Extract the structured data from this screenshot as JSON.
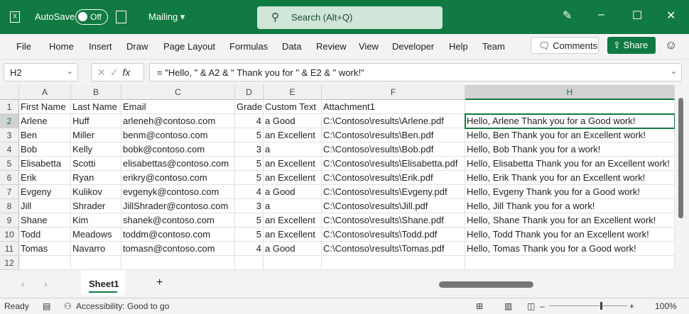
{
  "titlebar": {
    "autosave_label": "AutoSave",
    "autosave_state": "Off",
    "doc_name": "Mailing ▾",
    "search_placeholder": "Search (Alt+Q)"
  },
  "ribbon": {
    "tabs": [
      "File",
      "Home",
      "Insert",
      "Draw",
      "Page Layout",
      "Formulas",
      "Data",
      "Review",
      "View",
      "Developer",
      "Help",
      "Team"
    ],
    "comments": "Comments",
    "share": "Share"
  },
  "formula_bar": {
    "name_box": "H2",
    "fx": "fx",
    "formula": "= \"Hello, \" & A2 & \" Thank you for \" & E2 & \" work!\""
  },
  "grid": {
    "columns": [
      "A",
      "B",
      "C",
      "D",
      "E",
      "F",
      "H"
    ],
    "selected_column": "H",
    "active_cell": "H2",
    "rows": [
      [
        "First Name",
        "Last Name",
        "Email",
        "Grade",
        "Custom Text",
        "Attachment1",
        ""
      ],
      [
        "Arlene",
        "Huff",
        "arleneh@contoso.com",
        "4",
        "a Good",
        "C:\\Contoso\\results\\Arlene.pdf",
        "Hello, Arlene Thank you for a Good work!"
      ],
      [
        "Ben",
        "Miller",
        "benm@contoso.com",
        "5",
        "an Excellent",
        "C:\\Contoso\\results\\Ben.pdf",
        "Hello, Ben Thank you for an Excellent work!"
      ],
      [
        "Bob",
        "Kelly",
        "bobk@contoso.com",
        "3",
        "a",
        "C:\\Contoso\\results\\Bob.pdf",
        "Hello, Bob Thank you for a work!"
      ],
      [
        "Elisabetta",
        "Scotti",
        "elisabettas@contoso.com",
        "5",
        "an Excellent",
        "C:\\Contoso\\results\\Elisabetta.pdf",
        "Hello, Elisabetta Thank you for an Excellent work!"
      ],
      [
        "Erik",
        "Ryan",
        "erikry@contoso.com",
        "5",
        "an Excellent",
        "C:\\Contoso\\results\\Erik.pdf",
        "Hello, Erik Thank you for an Excellent work!"
      ],
      [
        "Evgeny",
        "Kulikov",
        "evgenyk@contoso.com",
        "4",
        "a Good",
        "C:\\Contoso\\results\\Evgeny.pdf",
        "Hello, Evgeny Thank you for a Good work!"
      ],
      [
        "Jill",
        "Shrader",
        "JillShrader@contoso.com",
        "3",
        "a",
        "C:\\Contoso\\results\\Jill.pdf",
        "Hello, Jill Thank you for a work!"
      ],
      [
        "Shane",
        "Kim",
        "shanek@contoso.com",
        "5",
        "an Excellent",
        "C:\\Contoso\\results\\Shane.pdf",
        "Hello, Shane Thank you for an Excellent work!"
      ],
      [
        "Todd",
        "Meadows",
        "toddm@contoso.com",
        "5",
        "an Excellent",
        "C:\\Contoso\\results\\Todd.pdf",
        "Hello, Todd Thank you for an Excellent work!"
      ],
      [
        "Tomas",
        "Navarro",
        "tomasn@contoso.com",
        "4",
        "a Good",
        "C:\\Contoso\\results\\Tomas.pdf",
        "Hello, Tomas Thank you for a Good work!"
      ],
      [
        "",
        "",
        "",
        "",
        "",
        "",
        ""
      ]
    ]
  },
  "sheets": {
    "tabs": [
      "Sheet1"
    ],
    "add": "+"
  },
  "status": {
    "ready": "Ready",
    "accessibility": "Accessibility: Good to go",
    "zoom": "100%"
  },
  "colors": {
    "brand": "#117a42"
  }
}
